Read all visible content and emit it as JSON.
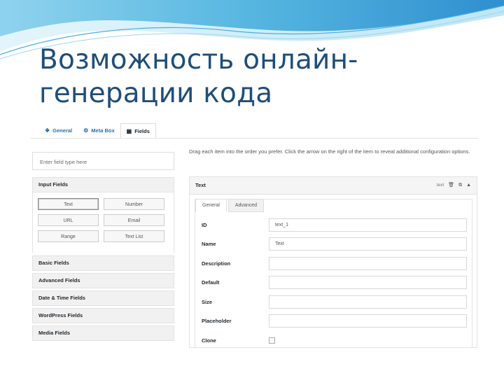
{
  "slide": {
    "title_line1": "Возможность онлайн-",
    "title_line2": "генерации кода"
  },
  "tabs": [
    {
      "label": "General",
      "icon": "info-circle-icon"
    },
    {
      "label": "Meta Box",
      "icon": "gear-icon"
    },
    {
      "label": "Fields",
      "icon": "grid-icon",
      "active": true
    }
  ],
  "search": {
    "placeholder": "Enter field type here"
  },
  "field_groups": {
    "input_fields": {
      "label": "Input Fields",
      "buttons": [
        "Text",
        "Number",
        "URL",
        "Email",
        "Range",
        "Text List"
      ],
      "selected": "Text"
    },
    "collapsed": [
      "Basic Fields",
      "Advanced Fields",
      "Date & Time Fields",
      "WordPress Fields",
      "Media Fields"
    ]
  },
  "hint": "Drag each item into the order you prefer. Click the arrow on the right of the item to reveal additional configuration options.",
  "panel": {
    "title": "Text",
    "type_tag": "text",
    "tools": [
      "trash-icon",
      "duplicate-icon",
      "collapse-arrow-icon"
    ],
    "inner_tabs": [
      "General",
      "Advanced"
    ],
    "fields": [
      {
        "label": "ID",
        "value": "text_1"
      },
      {
        "label": "Name",
        "value": "Text"
      },
      {
        "label": "Description",
        "value": ""
      },
      {
        "label": "Default",
        "value": ""
      },
      {
        "label": "Size",
        "value": ""
      },
      {
        "label": "Placeholder",
        "value": ""
      }
    ],
    "clone_label": "Clone",
    "clone_checked": false
  },
  "colors": {
    "title": "#1f4e79",
    "wave_dark": "#3aa0d8",
    "wave_light": "#bfe6f5",
    "tab_link": "#2271b1"
  }
}
